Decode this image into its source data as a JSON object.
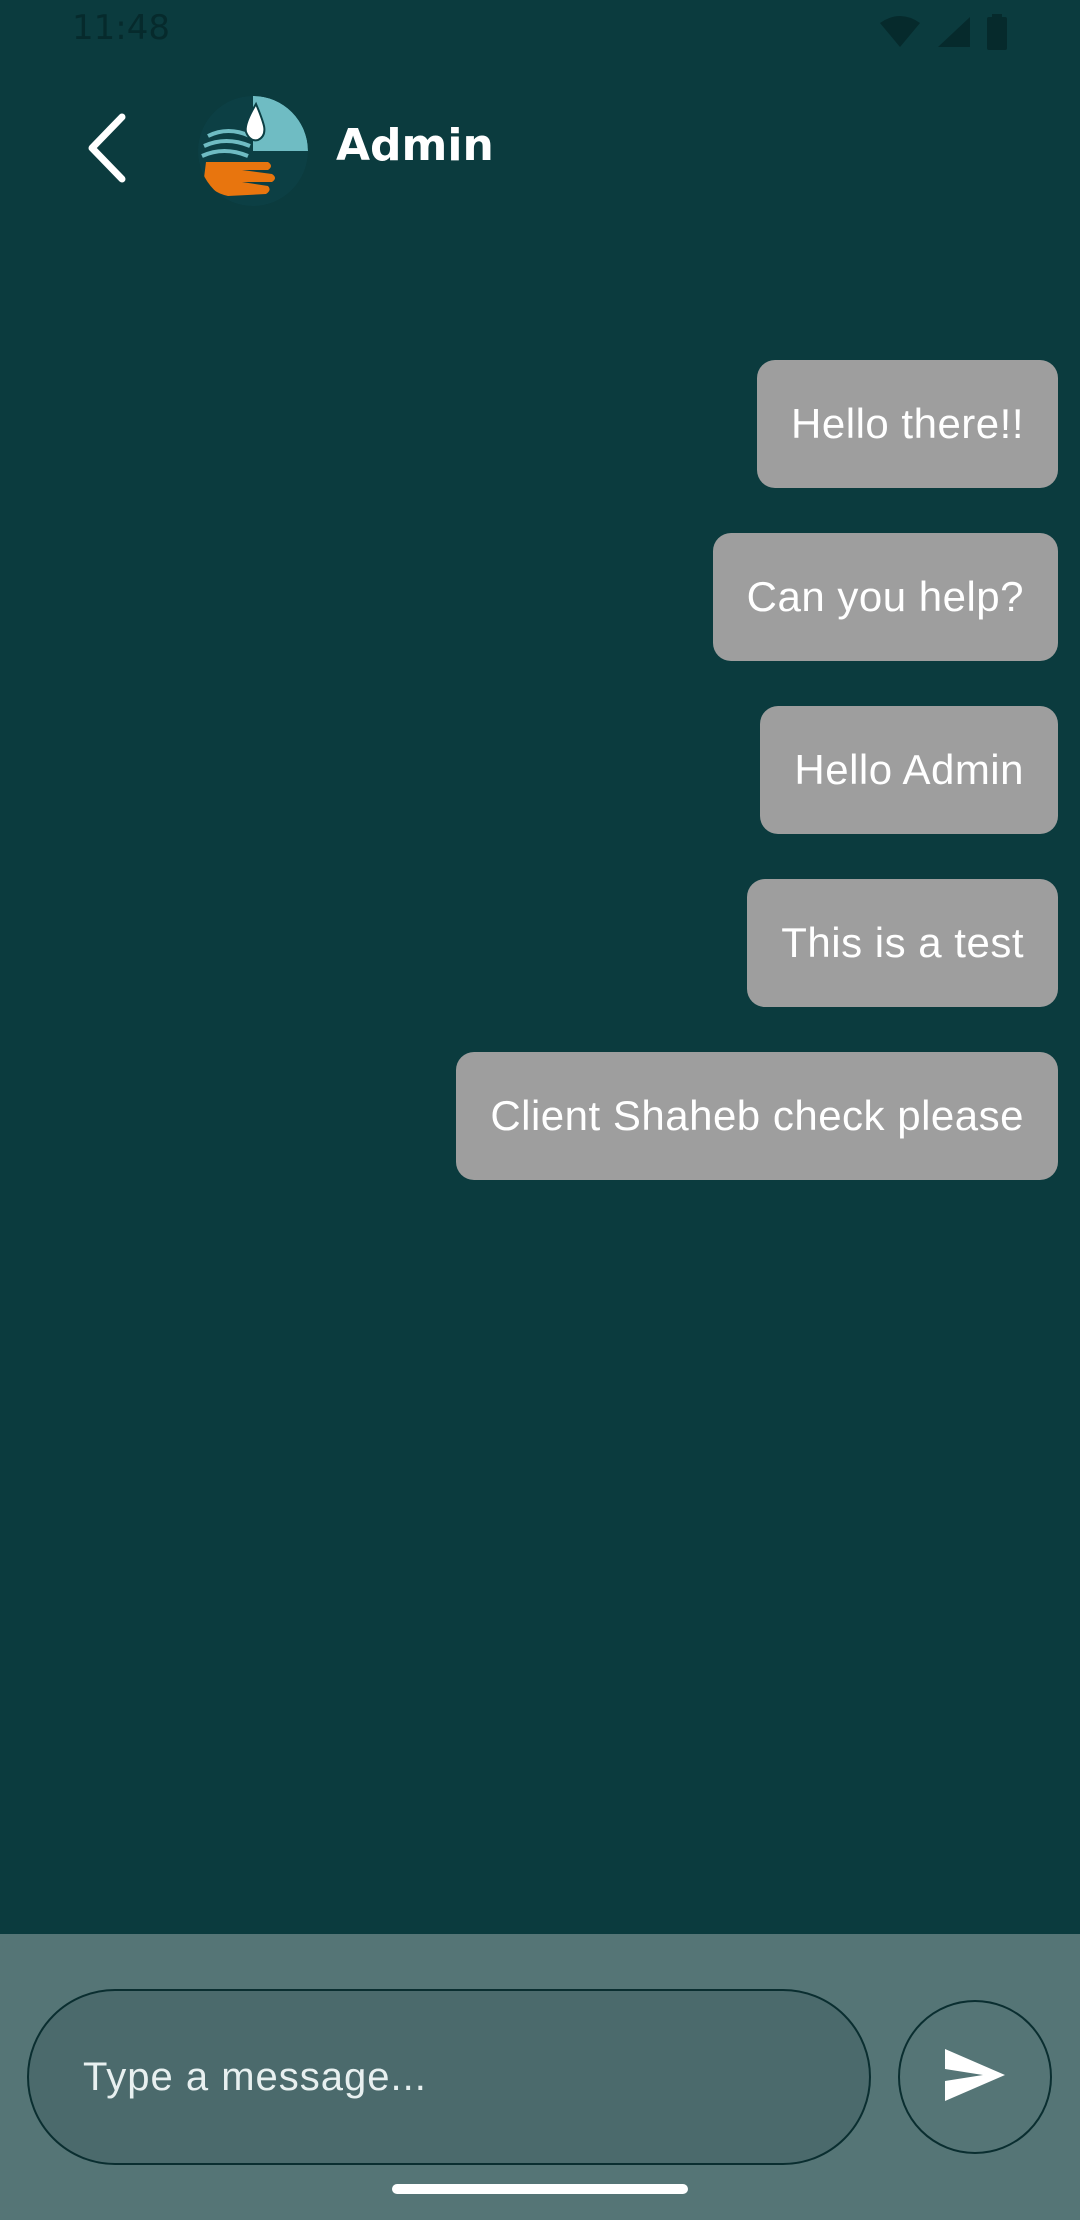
{
  "status_bar": {
    "time": "11:48",
    "icons": [
      "wifi-icon",
      "cell-signal-icon",
      "battery-icon"
    ]
  },
  "header": {
    "contact_name": "Admin",
    "back_icon": "chevron-left-icon",
    "avatar_icon": "water-hand-logo"
  },
  "messages": [
    {
      "text": "Hello there!!",
      "sender": "me"
    },
    {
      "text": "Can you help?",
      "sender": "me"
    },
    {
      "text": "Hello Admin",
      "sender": "me"
    },
    {
      "text": "This is a test",
      "sender": "me"
    },
    {
      "text": "Client Shaheb check please",
      "sender": "me"
    }
  ],
  "composer": {
    "placeholder": "Type a message...",
    "value": "",
    "send_icon": "send-icon"
  },
  "colors": {
    "background": "#0b3b3e",
    "bubble": "#9e9e9e",
    "input_bar": "#557576",
    "input_field": "#4b6a6c",
    "text": "#ffffff"
  }
}
